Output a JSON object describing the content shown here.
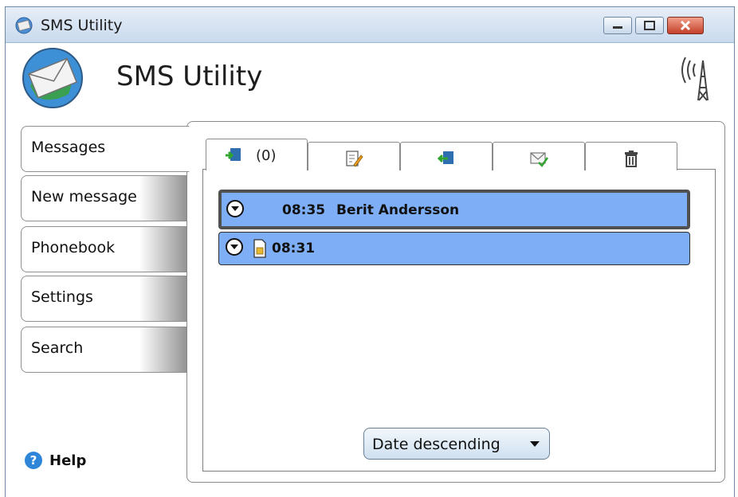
{
  "window": {
    "title": "SMS Utility"
  },
  "header": {
    "title": "SMS Utility"
  },
  "sidebar": {
    "items": [
      {
        "label": "Messages",
        "active": true
      },
      {
        "label": "New message",
        "active": false
      },
      {
        "label": "Phonebook",
        "active": false
      },
      {
        "label": "Settings",
        "active": false
      },
      {
        "label": "Search",
        "active": false
      }
    ],
    "help_label": "Help"
  },
  "tabs": [
    {
      "icon": "inbox-icon",
      "count": "(0)"
    },
    {
      "icon": "compose-icon"
    },
    {
      "icon": "outbox-icon"
    },
    {
      "icon": "sent-icon"
    },
    {
      "icon": "trash-icon"
    }
  ],
  "messages": [
    {
      "time": "08:35",
      "contact": "Berit Andersson",
      "selected": true
    },
    {
      "time": "08:31",
      "contact": "",
      "selected": false,
      "icon": "sim-card-icon"
    }
  ],
  "sort": {
    "label": "Date descending"
  },
  "colors": {
    "row": "#7eaef5",
    "accent": "#2f86d9"
  }
}
